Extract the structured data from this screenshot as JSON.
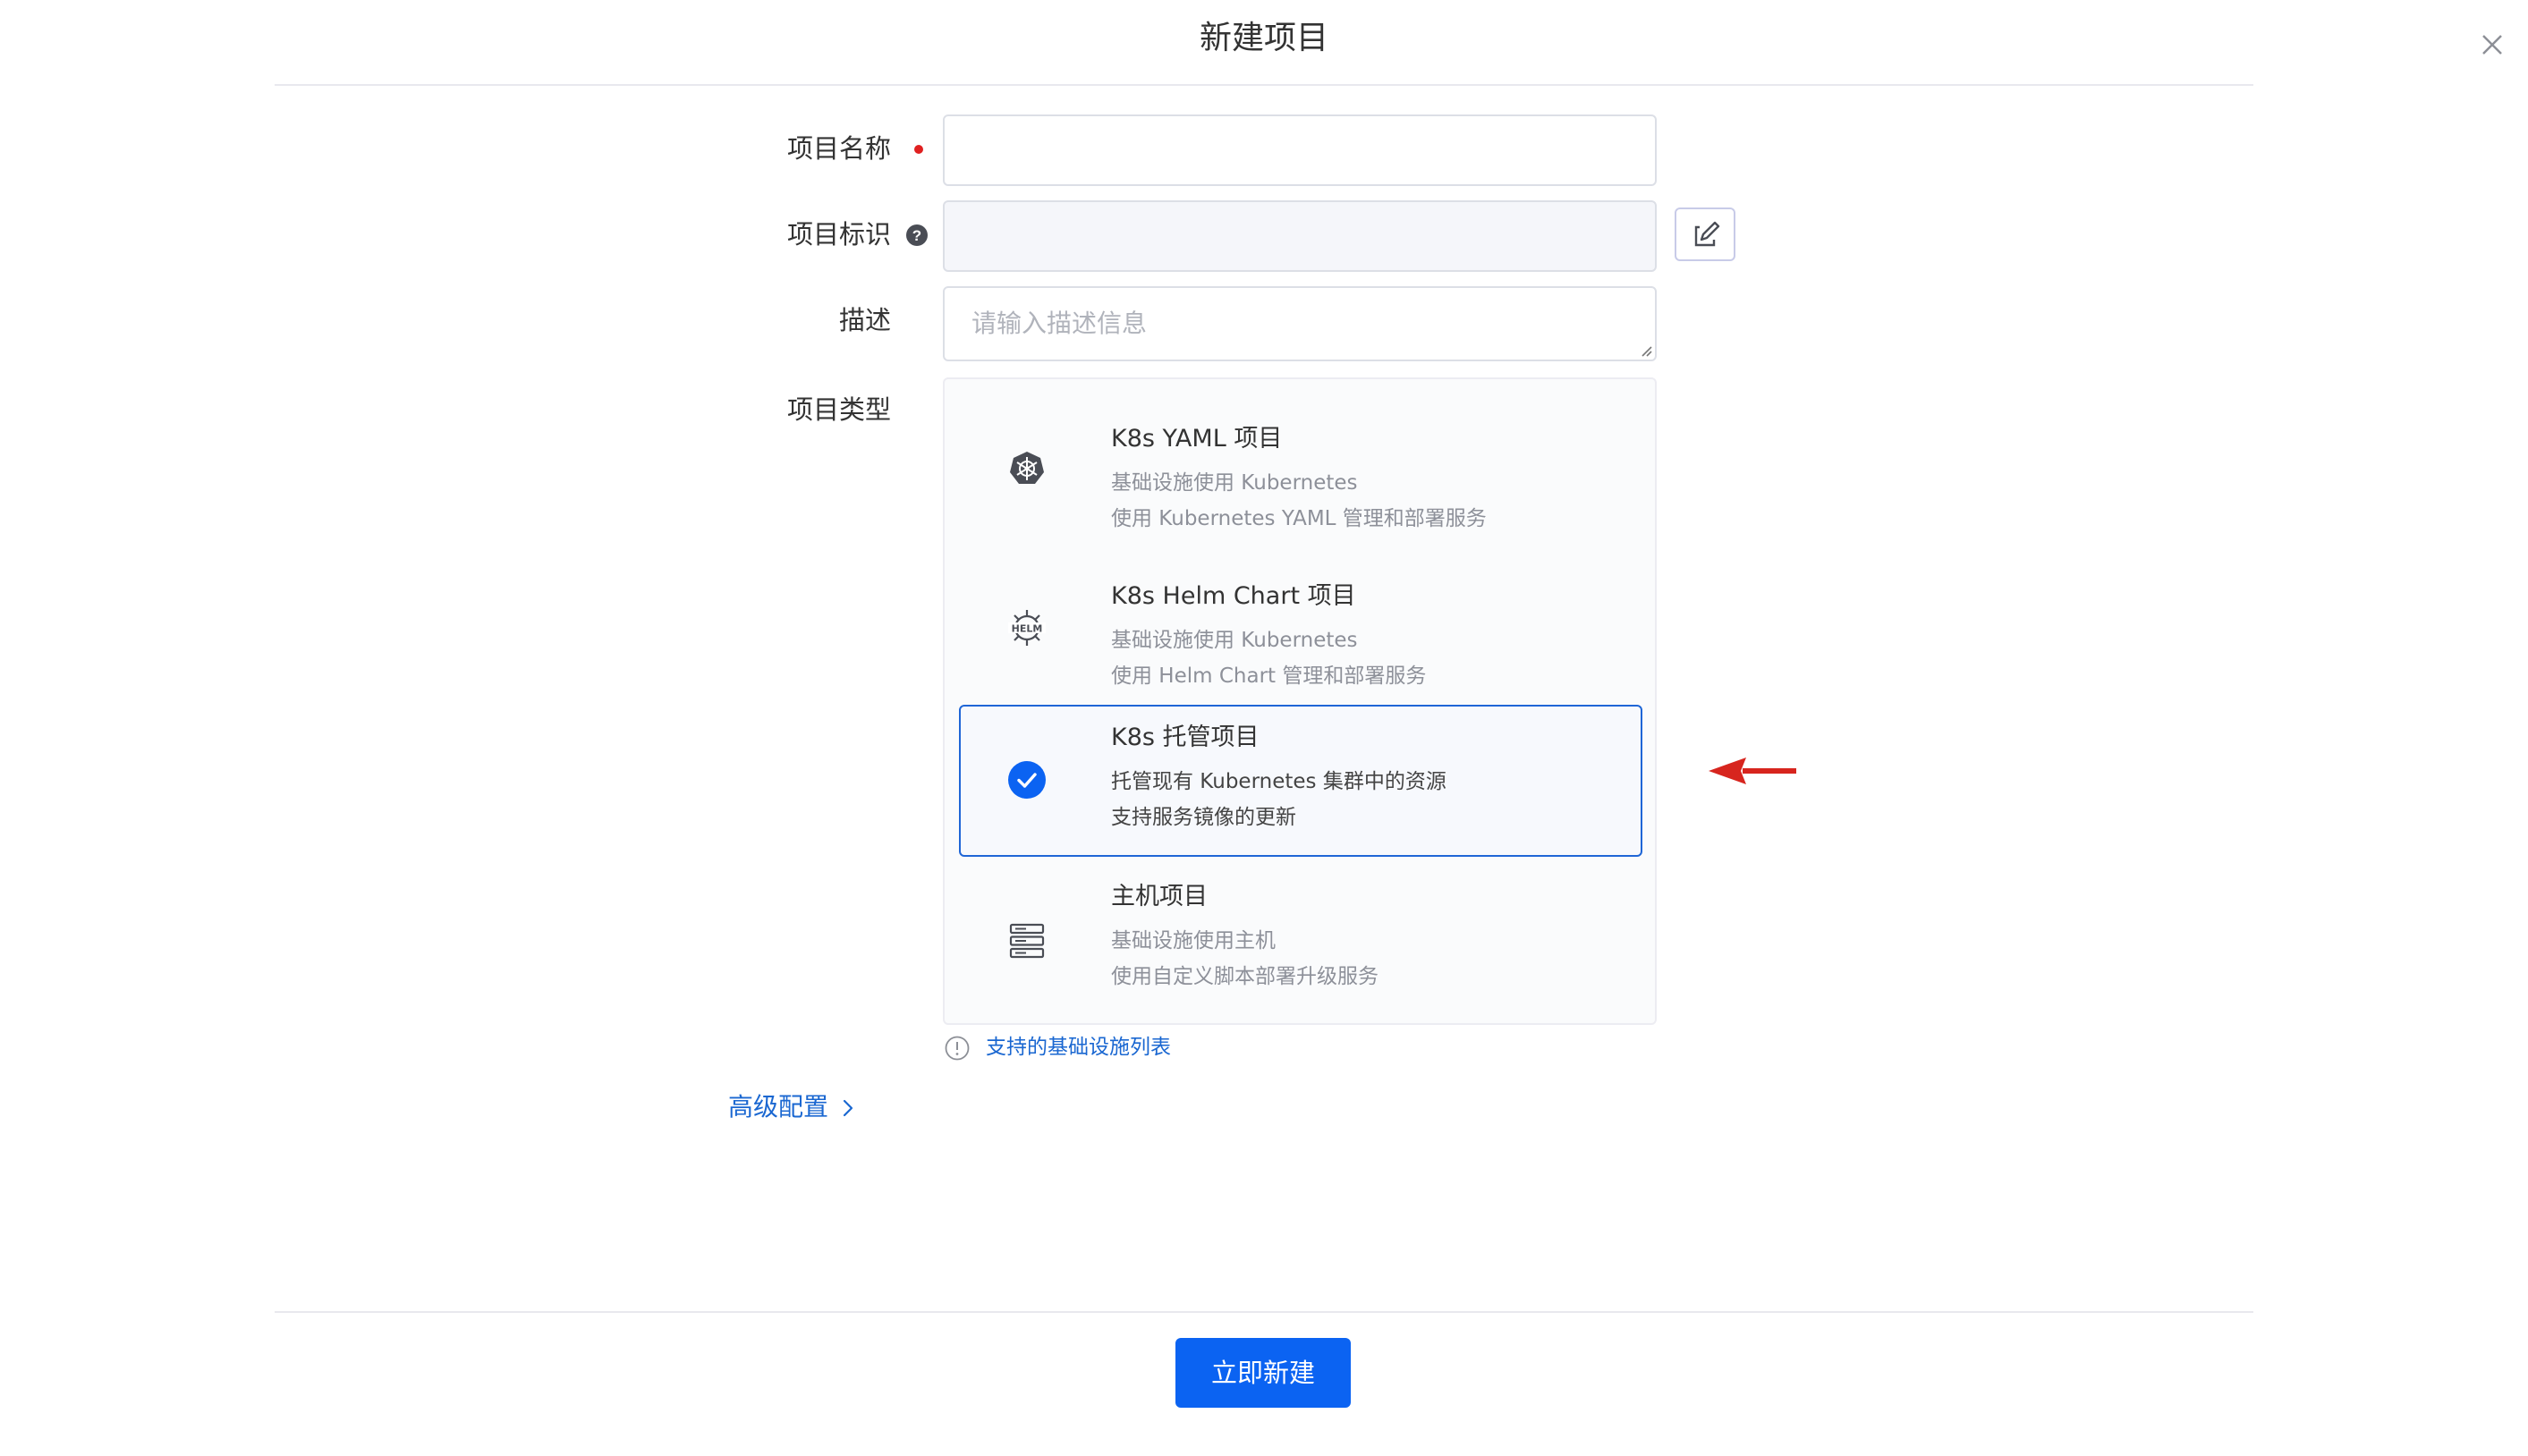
{
  "dialog": {
    "title": "新建项目"
  },
  "form": {
    "name_label": "项目名称",
    "identifier_label": "项目标识",
    "description_label": "描述",
    "description_placeholder": "请输入描述信息",
    "type_label": "项目类型"
  },
  "project_types": [
    {
      "title": "K8s YAML 项目",
      "line1": "基础设施使用 Kubernetes",
      "line2": "使用 Kubernetes YAML 管理和部署服务",
      "icon": "kubernetes-icon",
      "selected": false
    },
    {
      "title": "K8s Helm Chart 项目",
      "line1": "基础设施使用 Kubernetes",
      "line2": "使用 Helm Chart 管理和部署服务",
      "icon": "helm-icon",
      "selected": false
    },
    {
      "title": "K8s 托管项目",
      "line1": "托管现有 Kubernetes 集群中的资源",
      "line2": "支持服务镜像的更新",
      "icon": "check-circle-icon",
      "selected": true
    },
    {
      "title": "主机项目",
      "line1": "基础设施使用主机",
      "line2": "使用自定义脚本部署升级服务",
      "icon": "server-icon",
      "selected": false
    }
  ],
  "infra_link": "支持的基础设施列表",
  "advanced_link": "高级配置",
  "submit_label": "立即新建",
  "colors": {
    "primary": "#0b63f2",
    "link": "#1a67d1",
    "required": "#e02020",
    "annotation_arrow": "#d7251e"
  }
}
